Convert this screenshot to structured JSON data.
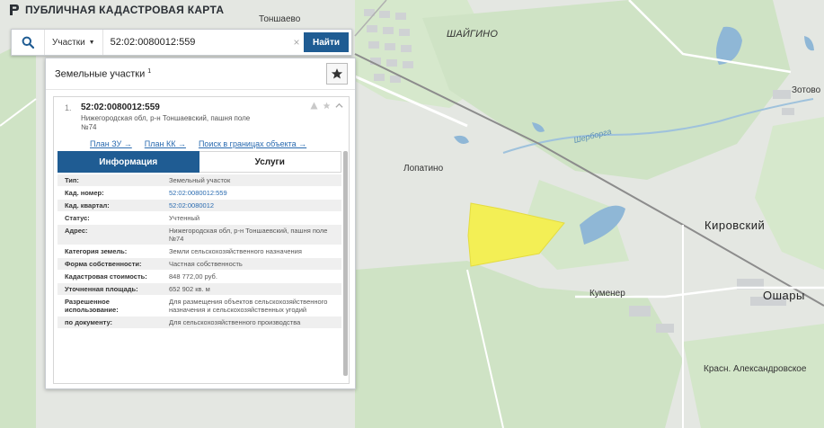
{
  "app": {
    "title": "ПУБЛИЧНАЯ КАДАСТРОВАЯ КАРТА"
  },
  "search": {
    "type_label": "Участки",
    "query": "52:02:0080012:559",
    "clear_label": "×",
    "button_label": "Найти"
  },
  "panel": {
    "title": "Земельные участки",
    "count": "1",
    "favorite_icon": "star-icon"
  },
  "result": {
    "number": "1.",
    "cadastral_id": "52:02:0080012:559",
    "address_line1": "Нижегородская обл, р-н Тоншаевский, пашня поле",
    "address_line2": "№74",
    "links": [
      "План ЗУ →",
      "План КК →",
      "Поиск в границах объекта →"
    ]
  },
  "tabs": {
    "info": "Информация",
    "services": "Услуги"
  },
  "info_rows": [
    {
      "label": "Тип:",
      "value": "Земельный участок"
    },
    {
      "label": "Кад. номер:",
      "value": "52:02:0080012:559"
    },
    {
      "label": "Кад. квартал:",
      "value": "52:02:0080012"
    },
    {
      "label": "Статус:",
      "value": "Учтенный"
    },
    {
      "label": "Адрес:",
      "value": "Нижегородская обл, р-н Тоншаевский, пашня поле №74"
    },
    {
      "label": "Категория земель:",
      "value": "Земли сельскохозяйственного назначения"
    },
    {
      "label": "Форма собственности:",
      "value": "Частная собственность"
    },
    {
      "label": "Кадастровая стоимость:",
      "value": "848 772,00 руб."
    },
    {
      "label": "Уточненная площадь:",
      "value": "652 902 кв. м"
    },
    {
      "label": "Разрешенное использование:",
      "value": "Для размещения объектов сельскохозяйственного назначения и сельскохозяйственных угодий"
    },
    {
      "label": "по документу:",
      "value": "Для сельскохозяйственного производства"
    }
  ],
  "map_labels": {
    "tonshaevo": "Тоншаево",
    "shaigino": "ШАЙГИНО",
    "zotovo": "Зотово",
    "lopatino": "Лопатино",
    "kirovsky": "Кировский",
    "kumener": "Куменер",
    "oshary": "Ошары",
    "krasn": "Красн. Александровское",
    "river": "Шерборга"
  },
  "colors": {
    "accent": "#1f5c93",
    "link": "#2a6bb0",
    "parcel": "#f3ef55",
    "forest": "#cfe3c5",
    "water": "#8fb7d6"
  }
}
